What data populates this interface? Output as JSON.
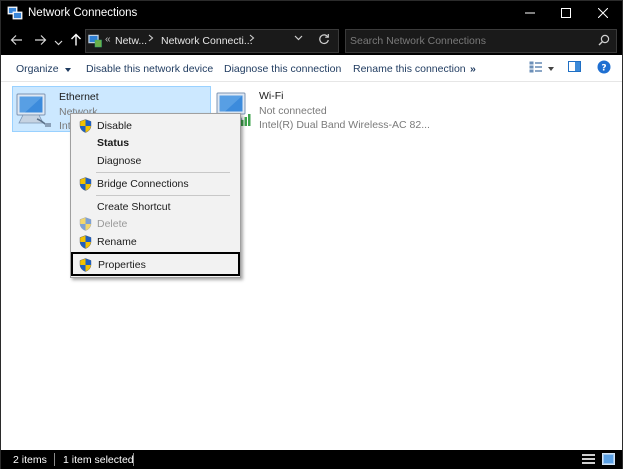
{
  "window": {
    "title": "Network Connections",
    "icons": {
      "app": "network-connections-icon",
      "minimize": "minimize-icon",
      "maximize": "maximize-icon",
      "close": "close-icon"
    }
  },
  "addressbar": {
    "crumbs": [
      "Netw...",
      "Network Connecti..."
    ],
    "overflow": "«",
    "search_placeholder": "Search Network Connections",
    "icons": {
      "back": "arrow-left-icon",
      "forward": "arrow-right-icon",
      "recent": "chevron-down-icon",
      "up": "arrow-up-icon",
      "location": "control-panel-icon",
      "refresh": "refresh-icon",
      "search": "search-icon"
    }
  },
  "commandbar": {
    "organize": "Organize",
    "disable": "Disable this network device",
    "diagnose": "Diagnose this connection",
    "rename": "Rename this connection",
    "more": "»",
    "icons": {
      "view": "change-view-icon",
      "preview_pane": "preview-pane-icon",
      "help": "help-icon"
    }
  },
  "items": [
    {
      "name": "Ethernet",
      "line2": "Network",
      "line3": "Intel...",
      "selected": true,
      "icon": "ethernet-adapter-icon"
    },
    {
      "name": "Wi-Fi",
      "line2": "Not connected",
      "line3": "Intel(R) Dual Band Wireless-AC 82...",
      "selected": false,
      "icon": "wifi-adapter-icon"
    }
  ],
  "context_menu": {
    "items": [
      {
        "label": "Disable",
        "shield": true,
        "bold": false,
        "disabled": false
      },
      {
        "label": "Status",
        "shield": false,
        "bold": true,
        "disabled": false
      },
      {
        "label": "Diagnose",
        "shield": false,
        "bold": false,
        "disabled": false
      },
      {
        "label": "Bridge Connections",
        "shield": true,
        "bold": false,
        "disabled": false
      },
      {
        "label": "Create Shortcut",
        "shield": false,
        "bold": false,
        "disabled": false
      },
      {
        "label": "Delete",
        "shield": true,
        "bold": false,
        "disabled": true
      },
      {
        "label": "Rename",
        "shield": true,
        "bold": false,
        "disabled": false
      },
      {
        "label": "Properties",
        "shield": true,
        "bold": false,
        "disabled": false,
        "highlighted": true
      }
    ],
    "icons": {
      "shield": "uac-shield-icon"
    }
  },
  "statusbar": {
    "item_count": "2 items",
    "selection": "1 item selected",
    "icons": {
      "details_view": "details-view-icon",
      "tiles_view": "large-icons-view-icon"
    }
  },
  "colors": {
    "selection_fill": "#cce8ff",
    "selection_border": "#99d1ff",
    "link_text": "#1e3a5f",
    "shield_blue": "#1f5fbf",
    "shield_yellow": "#f2c200"
  }
}
